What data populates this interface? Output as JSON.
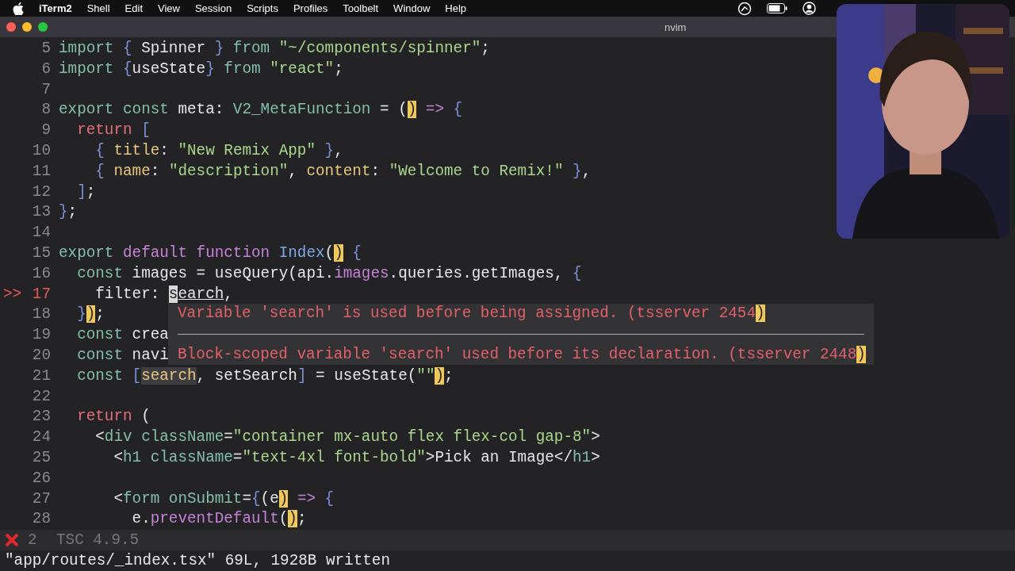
{
  "menu_bar": {
    "app": "iTerm2",
    "items": [
      "Shell",
      "Edit",
      "View",
      "Session",
      "Scripts",
      "Profiles",
      "Toolbelt",
      "Window",
      "Help"
    ]
  },
  "window": {
    "title": "nvim"
  },
  "editor": {
    "lines": [
      {
        "number": "5",
        "tokens": [
          {
            "kind": "k",
            "text": "import "
          },
          {
            "kind": "b",
            "text": "{"
          },
          {
            "kind": "p",
            "text": " Spinner "
          },
          {
            "kind": "b",
            "text": "}"
          },
          {
            "kind": "k",
            "text": " from "
          },
          {
            "kind": "s",
            "text": "\"~/components/spinner\""
          },
          {
            "kind": "p",
            "text": ";"
          }
        ]
      },
      {
        "number": "6",
        "tokens": [
          {
            "kind": "k",
            "text": "import "
          },
          {
            "kind": "b",
            "text": "{"
          },
          {
            "kind": "p",
            "text": "useState"
          },
          {
            "kind": "b",
            "text": "}"
          },
          {
            "kind": "k",
            "text": " from "
          },
          {
            "kind": "s",
            "text": "\"react\""
          },
          {
            "kind": "p",
            "text": ";"
          }
        ]
      },
      {
        "number": "7"
      },
      {
        "number": "8",
        "tokens": [
          {
            "kind": "k",
            "text": "export const "
          },
          {
            "kind": "p",
            "text": "meta: "
          },
          {
            "kind": "k",
            "text": "V2_MetaFunction"
          },
          {
            "kind": "p",
            "text": " = ("
          },
          {
            "kind": "m",
            "text": ")"
          },
          {
            "kind": "f",
            "text": " => "
          },
          {
            "kind": "b",
            "text": "{"
          }
        ]
      },
      {
        "number": "9",
        "tokens": [
          {
            "kind": "r",
            "text": "  return "
          },
          {
            "kind": "b",
            "text": "["
          }
        ]
      },
      {
        "number": "10",
        "tokens": [
          {
            "kind": "b",
            "text": "    { "
          },
          {
            "kind": "y",
            "text": "title"
          },
          {
            "kind": "p",
            "text": ": "
          },
          {
            "kind": "s",
            "text": "\"New Remix App\" "
          },
          {
            "kind": "b",
            "text": "}"
          },
          {
            "kind": "p",
            "text": ","
          }
        ]
      },
      {
        "number": "11",
        "tokens": [
          {
            "kind": "b",
            "text": "    { "
          },
          {
            "kind": "y",
            "text": "name"
          },
          {
            "kind": "p",
            "text": ": "
          },
          {
            "kind": "s",
            "text": "\"description\""
          },
          {
            "kind": "p",
            "text": ", "
          },
          {
            "kind": "y",
            "text": "content"
          },
          {
            "kind": "p",
            "text": ": "
          },
          {
            "kind": "s",
            "text": "\"Welcome to Remix!\" "
          },
          {
            "kind": "b",
            "text": "}"
          },
          {
            "kind": "p",
            "text": ","
          }
        ]
      },
      {
        "number": "12",
        "tokens": [
          {
            "kind": "b",
            "text": "  ]"
          },
          {
            "kind": "p",
            "text": ";"
          }
        ]
      },
      {
        "number": "13",
        "tokens": [
          {
            "kind": "b",
            "text": "}"
          },
          {
            "kind": "p",
            "text": ";"
          }
        ]
      },
      {
        "number": "14"
      },
      {
        "number": "15",
        "tokens": [
          {
            "kind": "k",
            "text": "export "
          },
          {
            "kind": "f",
            "text": "default function "
          },
          {
            "kind": "n",
            "text": "Index"
          },
          {
            "kind": "p",
            "text": "("
          },
          {
            "kind": "m",
            "text": ")"
          },
          {
            "kind": "b",
            "text": " {"
          }
        ]
      },
      {
        "number": "16",
        "tokens": [
          {
            "kind": "k",
            "text": "  const "
          },
          {
            "kind": "p",
            "text": "images = useQuery(api."
          },
          {
            "kind": "f",
            "text": "images"
          },
          {
            "kind": "p",
            "text": ".queries.getImages, "
          },
          {
            "kind": "b",
            "text": "{"
          }
        ]
      },
      {
        "number": "17",
        "sign": ">>",
        "tokens": [
          {
            "kind": "p",
            "text": "    filter: "
          },
          {
            "kind": "c",
            "text": "s"
          },
          {
            "kind": "u",
            "text": "earch"
          },
          {
            "kind": "p",
            "text": ","
          }
        ]
      },
      {
        "number": "18",
        "tokens": [
          {
            "kind": "b",
            "text": "  }"
          },
          {
            "kind": "m",
            "text": ")"
          },
          {
            "kind": "p",
            "text": ";"
          }
        ]
      },
      {
        "number": "19",
        "tokens": [
          {
            "kind": "k",
            "text": "  const "
          },
          {
            "kind": "p",
            "text": "crea"
          }
        ]
      },
      {
        "number": "20",
        "tokens": [
          {
            "kind": "k",
            "text": "  const "
          },
          {
            "kind": "p",
            "text": "navi"
          }
        ]
      },
      {
        "number": "21",
        "tokens": [
          {
            "kind": "k",
            "text": "  const "
          },
          {
            "kind": "b",
            "text": "["
          },
          {
            "kind": "h",
            "text": "search"
          },
          {
            "kind": "p",
            "text": ", setSearch"
          },
          {
            "kind": "b",
            "text": "]"
          },
          {
            "kind": "p",
            "text": " = useState("
          },
          {
            "kind": "s",
            "text": "\"\""
          },
          {
            "kind": "m",
            "text": ")"
          },
          {
            "kind": "p",
            "text": ";"
          }
        ]
      },
      {
        "number": "22"
      },
      {
        "number": "23",
        "tokens": [
          {
            "kind": "r",
            "text": "  return "
          },
          {
            "kind": "p",
            "text": "("
          }
        ]
      },
      {
        "number": "24",
        "tokens": [
          {
            "kind": "p",
            "text": "    <"
          },
          {
            "kind": "k",
            "text": "div className"
          },
          {
            "kind": "p",
            "text": "="
          },
          {
            "kind": "s",
            "text": "\"container mx-auto flex flex-col gap-8\""
          },
          {
            "kind": "p",
            "text": ">"
          }
        ]
      },
      {
        "number": "25",
        "tokens": [
          {
            "kind": "p",
            "text": "      <"
          },
          {
            "kind": "k",
            "text": "h1 className"
          },
          {
            "kind": "p",
            "text": "="
          },
          {
            "kind": "s",
            "text": "\"text-4xl font-bold\""
          },
          {
            "kind": "p",
            "text": ">Pick an Image</"
          },
          {
            "kind": "k",
            "text": "h1"
          },
          {
            "kind": "p",
            "text": ">"
          }
        ]
      },
      {
        "number": "26"
      },
      {
        "number": "27",
        "tokens": [
          {
            "kind": "p",
            "text": "      <"
          },
          {
            "kind": "k",
            "text": "form onSubmit"
          },
          {
            "kind": "p",
            "text": "="
          },
          {
            "kind": "b",
            "text": "{"
          },
          {
            "kind": "p",
            "text": "(e"
          },
          {
            "kind": "m",
            "text": ")"
          },
          {
            "kind": "f",
            "text": " => "
          },
          {
            "kind": "b",
            "text": "{"
          }
        ]
      },
      {
        "number": "28",
        "tokens": [
          {
            "kind": "p",
            "text": "        e."
          },
          {
            "kind": "f",
            "text": "preventDefault"
          },
          {
            "kind": "p",
            "text": "("
          },
          {
            "kind": "m",
            "text": ")"
          },
          {
            "kind": "p",
            "text": ";"
          }
        ]
      }
    ]
  },
  "diagnostics": [
    {
      "text": "Variable 'search' is used before being assigned. (tsserver 2454",
      "close": ")"
    },
    {
      "text": "Block-scoped variable 'search' used before its declaration. (tsserver 2448",
      "close": ")"
    }
  ],
  "status_line": {
    "error_count": "2",
    "text": "TSC 4.9.5"
  },
  "command_line": "\"app/routes/_index.tsx\" 69L, 1928B written"
}
